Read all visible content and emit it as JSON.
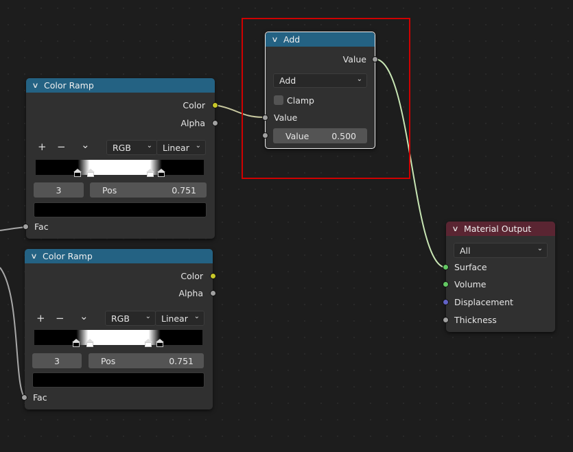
{
  "add_node": {
    "title": "Add",
    "output_value": "Value",
    "operation": "Add",
    "clamp_label": "Clamp",
    "input_value": "Value",
    "value_field_label": "Value",
    "value_field_value": "0.500"
  },
  "color_ramp_1": {
    "title": "Color Ramp",
    "out_color": "Color",
    "out_alpha": "Alpha",
    "add": "+",
    "remove": "−",
    "menu": "⌄",
    "color_mode": "RGB",
    "interpolation": "Linear",
    "index": "3",
    "pos_label": "Pos",
    "pos_value": "0.751",
    "in_fac": "Fac"
  },
  "color_ramp_2": {
    "title": "Color Ramp",
    "out_color": "Color",
    "out_alpha": "Alpha",
    "add": "+",
    "remove": "−",
    "menu": "⌄",
    "color_mode": "RGB",
    "interpolation": "Linear",
    "index": "3",
    "pos_label": "Pos",
    "pos_value": "0.751",
    "in_fac": "Fac"
  },
  "material_output": {
    "title": "Material Output",
    "target": "All",
    "surface": "Surface",
    "volume": "Volume",
    "displacement": "Displacement",
    "thickness": "Thickness"
  },
  "colors": {
    "node_header_blue": "#246283",
    "output_header": "#5a2532",
    "socket_gray": "#a1a1a1",
    "socket_yellow": "#c7c729",
    "socket_green": "#63c763",
    "socket_purple": "#6363c7",
    "wire": "#c8e6b4",
    "selection_box": "#d00000"
  }
}
